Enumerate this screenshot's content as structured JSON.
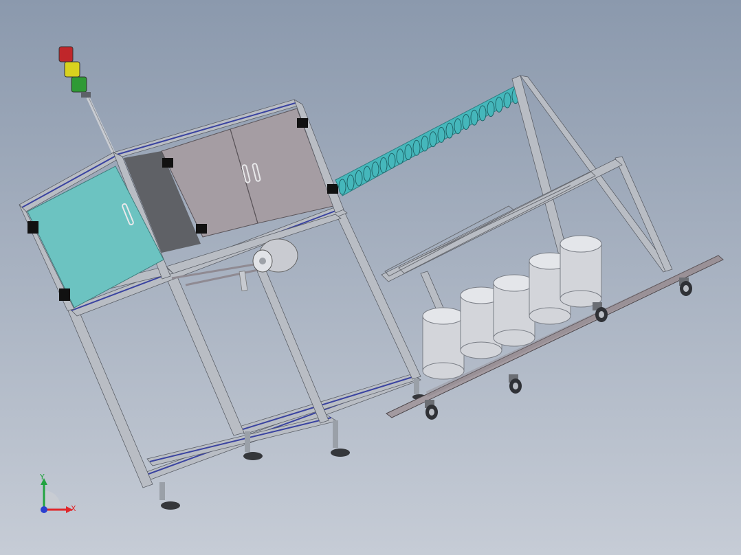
{
  "viewport": {
    "background_top": "#8b99ad",
    "background_bottom": "#c6ccd6"
  },
  "model": {
    "frame_color": "#b9bdc4",
    "panel_color": "#a59da3",
    "glass_color": "#6cc3c1",
    "screw_color": "#45b7bb",
    "cylinder_color": "#d3d5da",
    "cart_plate_color": "#a39aa0"
  },
  "signal_tower": {
    "colors": [
      "#c0262a",
      "#d9d21e",
      "#2f9a35"
    ]
  },
  "triad": {
    "x_label": "X",
    "y_label": "Y",
    "x_color": "#e0262a",
    "y_color": "#22a340",
    "z_color": "#2b3fd0"
  }
}
